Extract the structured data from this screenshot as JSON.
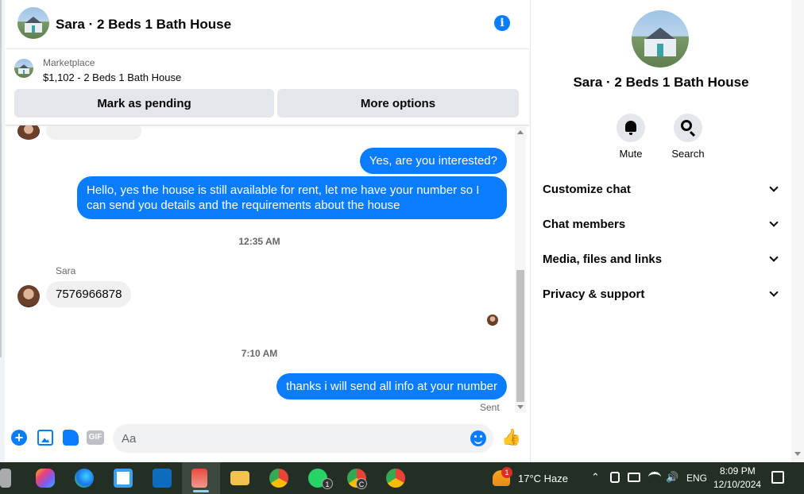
{
  "header": {
    "title": "Sara · 2 Beds 1 Bath House",
    "info_icon": "info-icon"
  },
  "marketplace": {
    "label": "Marketplace",
    "listing": "$1,102 - 2 Beds 1 Bath House",
    "mark_pending_label": "Mark as pending",
    "more_options_label": "More options"
  },
  "messages": [
    {
      "direction": "out",
      "text": "Yes, are you interested?"
    },
    {
      "direction": "out",
      "text": "Hello, yes the house is still available for rent, let me have your number so I can send you details and the requirements about the house"
    },
    {
      "type": "timestamp",
      "text": "12:35 AM"
    },
    {
      "direction": "in",
      "sender": "Sara",
      "text": "7576966878"
    },
    {
      "type": "timestamp",
      "text": "7:10 AM"
    },
    {
      "direction": "out",
      "text": "thanks i will send all info at your number",
      "status": "Sent"
    }
  ],
  "composer": {
    "placeholder": "Aa",
    "gif_label": "GIF"
  },
  "right_panel": {
    "title": "Sara · 2 Beds 1 Bath House",
    "actions": [
      {
        "label": "Mute",
        "icon": "bell-icon"
      },
      {
        "label": "Search",
        "icon": "search-icon"
      }
    ],
    "sections": [
      "Customize chat",
      "Chat members",
      "Media, files and links",
      "Privacy & support"
    ]
  },
  "taskbar": {
    "weather": "17°C  Haze",
    "weather_badge": "1",
    "language": "ENG",
    "time": "8:09 PM",
    "date": "12/10/2024",
    "whatsapp_badge": "1",
    "chrome_profile_badge": "C"
  },
  "colors": {
    "accent": "#0a7cff",
    "taskbar": "#232f24"
  }
}
